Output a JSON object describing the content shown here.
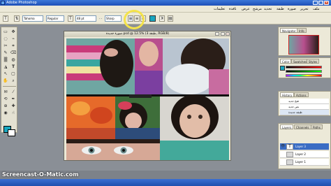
{
  "window": {
    "title": "Adobe Photoshop"
  },
  "menu": {
    "items": [
      "ملف",
      "تحرير",
      "صورة",
      "طبقة",
      "تحديد",
      "مرشح",
      "عرض",
      "نافذة",
      "تعليمات"
    ]
  },
  "options": {
    "font_family": "Tahoma",
    "font_style": "Regular",
    "font_size": "48 pt",
    "antialias": "Sharp",
    "dash": "- -",
    "warp_glyph": "ꓘ",
    "text_color": "#19a6bf"
  },
  "toolbox": {
    "tools": [
      "▭",
      "✥",
      "◌",
      "⌁",
      "✂",
      "⌗",
      "✎",
      "⌫",
      "▒",
      "◍",
      "◮",
      "T",
      "↖",
      "▢",
      "✋",
      "⌕"
    ]
  },
  "document": {
    "title": "صورة جديدة.psd @ 12.5% (طبقة 3, RGB/8)"
  },
  "panels": {
    "navigator": {
      "tabs": [
        "Navigator",
        "Info"
      ]
    },
    "color": {
      "tabs": [
        "Color",
        "Swatches",
        "Styles"
      ]
    },
    "history": {
      "tabs": [
        "History",
        "Actions"
      ],
      "items": [
        "فتح جديد",
        "نص جديد",
        "طبقة جديدة"
      ]
    },
    "layers": {
      "tabs": [
        "Layers",
        "Channels",
        "Paths"
      ],
      "rows": [
        {
          "eye": "👁",
          "name": "Layer 3"
        },
        {
          "eye": "",
          "name": "Layer 2"
        },
        {
          "eye": "",
          "name": "Layer 1"
        },
        {
          "eye": "",
          "name": "Background"
        }
      ]
    }
  },
  "watermark": "Screencast-O-Matic.com"
}
